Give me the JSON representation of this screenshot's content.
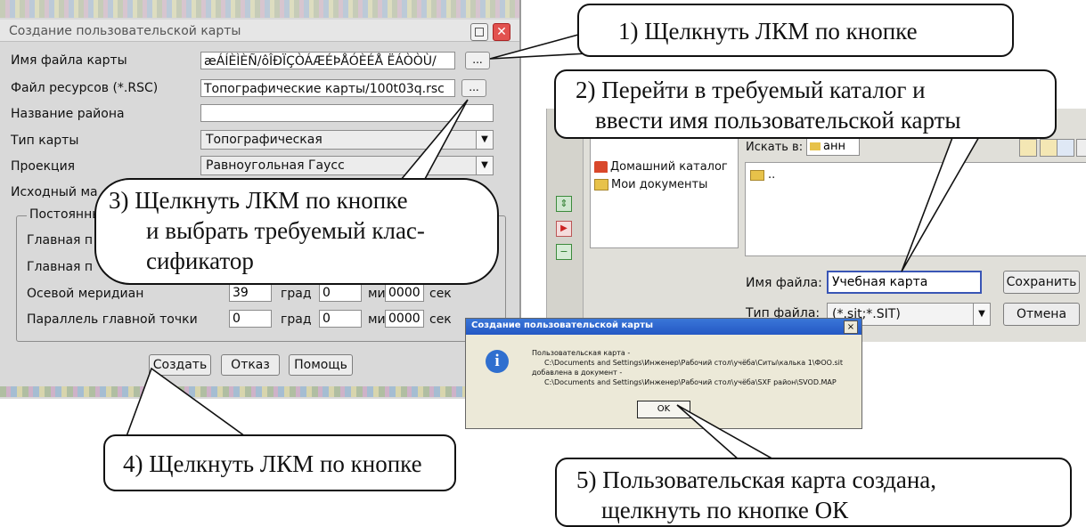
{
  "create_dialog": {
    "title": "Создание пользовательской карты",
    "rows": [
      {
        "label": "Имя файла карты",
        "value": "æÁÍÈÌÈÑ/ôÎÐÏÇÒÁÆÉÞÅÓÈÉÅ ËÁÒÒÙ/",
        "button": "..."
      },
      {
        "label": "Файл ресурсов (*.RSC)",
        "value": "Топографические карты/100t03q.rsc",
        "button": "..."
      },
      {
        "label": "Название района",
        "value": ""
      },
      {
        "label": "Тип карты",
        "value": "Топографическая"
      },
      {
        "label": "Проекция",
        "value": "Равноугольная Гаусс"
      },
      {
        "label": "Исходный ма"
      }
    ],
    "group_label": "Постоянны",
    "param_rows": [
      {
        "label": "Главная п"
      },
      {
        "label": "Главная п"
      },
      {
        "label": "Осевой меридиан",
        "deg": "39",
        "min": "0",
        "sec": "0000"
      },
      {
        "label": "Параллель главной точки",
        "deg": "0",
        "min": "0",
        "sec": "0000"
      }
    ],
    "units": {
      "deg": "град",
      "min": "мин",
      "sec": "сек"
    },
    "buttons": {
      "create": "Создать",
      "cancel": "Отказ",
      "help": "Помощь"
    }
  },
  "save_dialog": {
    "lookin_label": "Искать в:",
    "lookin_value": "анн",
    "places": [
      "Домашний каталог",
      "Мои документы"
    ],
    "list_item": "..",
    "filename_label": "Имя файла:",
    "filename_value": "Учебная карта",
    "filetype_label": "Тип файла:",
    "filetype_value": "(*.sit;*.SIT)",
    "save_button": "Сохранить",
    "cancel_button": "Отмена"
  },
  "message_dialog": {
    "title": "Создание пользовательской карты",
    "close": "×",
    "line1": "Пользовательская карта -",
    "line2": "C:\\Documents and Settings\\Инженер\\Рабочий стол\\учёба\\Ситы\\калька 1\\ФОО.sit",
    "line3": "добавлена в документ -",
    "line4": "C:\\Documents and Settings\\Инженер\\Рабочий стол\\учёба\\SXF район\\SVOD.MAP",
    "ok_button": "OK"
  },
  "callouts": {
    "c1": "1) Щелкнуть ЛКМ по кнопке",
    "c2_line1": "2) Перейти в требуемый каталог и",
    "c2_line2": "ввести имя пользовательской карты",
    "c3_line1": "3) Щелкнуть ЛКМ по кнопке",
    "c3_line2": "и выбрать требуемый клас-",
    "c3_line3": "сификатор",
    "c4": "4) Щелкнуть ЛКМ по кнопке",
    "c5_line1": "5) Пользовательская карта создана,",
    "c5_line2": "щелкнуть по кнопке ОК"
  },
  "colors": {
    "callout_border": "#111111",
    "dialog_bg": "#d9d9d9",
    "xp_title": "#2458c4"
  },
  "icons": [
    "restore-icon",
    "close-icon",
    "home-folder-icon",
    "documents-folder-icon",
    "folder-icon",
    "info-icon",
    "chevron-down-icon"
  ]
}
